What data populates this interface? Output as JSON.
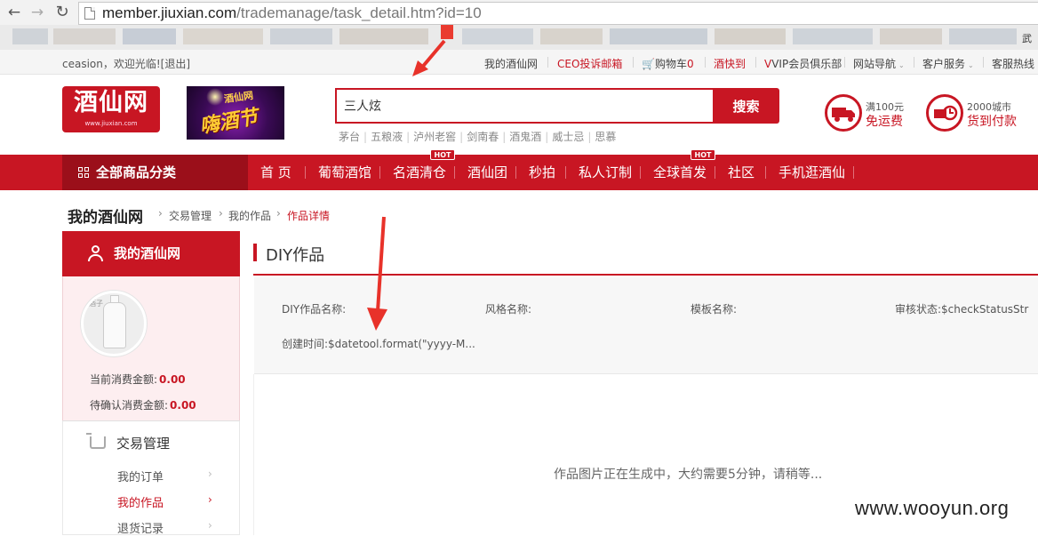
{
  "browser": {
    "back_icon": "arrow-left",
    "forward_icon": "arrow-right",
    "reload_icon": "reload",
    "url_host": "member.jiuxian.com",
    "url_path": "/trademanage/task_detail.htm?id=10",
    "bookmark_end_text": "武"
  },
  "topbar": {
    "welcome": "ceasion，欢迎光临![退出]",
    "links": [
      "我的酒仙网",
      "CEO投诉邮箱",
      "购物车",
      "0",
      "酒快到",
      "VIP会员俱乐部",
      "网站导航",
      "客户服务",
      "客服热线"
    ]
  },
  "header": {
    "logo_text": "酒仙网",
    "logo_sub": "www.jiuxian.com",
    "banner_top": "酒仙网",
    "banner_main": "嗨酒节",
    "search_value": "三人炫",
    "search_button": "搜索",
    "hot_words": [
      "茅台",
      "五粮液",
      "泸州老窖",
      "剑南春",
      "酒鬼酒",
      "威士忌",
      "思慕"
    ],
    "service1_line1": "满100元",
    "service1_line2": "免运费",
    "service2_line1": "2000城市",
    "service2_line2": "货到付款"
  },
  "nav": {
    "all_categories": "全部商品分类",
    "items": [
      "首 页",
      "葡萄酒馆",
      "名酒清仓",
      "酒仙团",
      "秒拍",
      "私人订制",
      "全球首发",
      "社区",
      "手机逛酒仙"
    ],
    "hot_badge": "HOT"
  },
  "breadcrumb": {
    "title": "我的酒仙网",
    "items": [
      "交易管理",
      "我的作品",
      "作品详情"
    ]
  },
  "sidebar": {
    "header": "我的酒仙网",
    "avatar_caption": "酒子",
    "current_amount_label": "当前消费金额:",
    "current_amount": "0.00",
    "pending_amount_label": "待确认消费金额:",
    "pending_amount": "0.00",
    "group_title": "交易管理",
    "links": [
      "我的订单",
      "我的作品",
      "退货记录"
    ],
    "active_index": 1
  },
  "content": {
    "title": "DIY作品",
    "fields": {
      "name_label": "DIY作品名称:",
      "style_label": "风格名称:",
      "template_label": "模板名称:",
      "status_label": "审核状态:",
      "status_value": "$checkStatusStr",
      "created_label": "创建时间:",
      "created_value": "$datetool.format(\"yyyy-M..."
    },
    "generating_text": "作品图片正在生成中，大约需要5分钟，请稍等..."
  },
  "watermark": "www.wooyun.org",
  "colors": {
    "brand_red": "#c81623",
    "nav_dark": "#9b0f1a",
    "sidebar_bg": "#fdeef0"
  }
}
